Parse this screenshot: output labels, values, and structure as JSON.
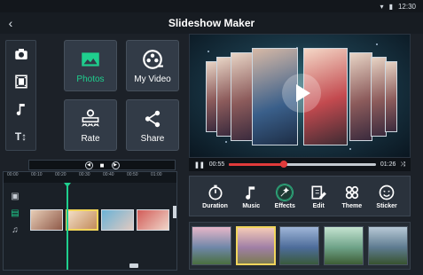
{
  "status": {
    "time": "12:30"
  },
  "app": {
    "title": "Slideshow Maker",
    "back_icon": "back-arrow-icon"
  },
  "tools": [
    {
      "name": "camera-icon"
    },
    {
      "name": "film-icon"
    },
    {
      "name": "music-note-icon"
    },
    {
      "name": "text-icon",
      "glyph": "T↕"
    }
  ],
  "tiles": {
    "photos": "Photos",
    "my_video": "My Video",
    "rate": "Rate",
    "share": "Share"
  },
  "player": {
    "current_time": "00:55",
    "total_time": "01:26",
    "progress": 0.37
  },
  "effects": [
    {
      "label": "Duration",
      "icon": "timer-icon"
    },
    {
      "label": "Music",
      "icon": "music-note-icon"
    },
    {
      "label": "Effects",
      "icon": "magic-icon",
      "active": true
    },
    {
      "label": "Edit",
      "icon": "edit-icon"
    },
    {
      "label": "Theme",
      "icon": "theme-icon"
    },
    {
      "label": "Sticker",
      "icon": "sticker-icon"
    }
  ],
  "filters": [
    {
      "colors": [
        "#e7b6c9",
        "#6f87a8",
        "#4a6f3f"
      ],
      "selected": false
    },
    {
      "colors": [
        "#f3c9b7",
        "#a07fa6",
        "#7c7b52"
      ],
      "selected": true
    },
    {
      "colors": [
        "#9fb6d8",
        "#4d6c9a",
        "#3a5a3c"
      ],
      "selected": false
    },
    {
      "colors": [
        "#c4e3d0",
        "#6ea288",
        "#3d5d35"
      ],
      "selected": false
    },
    {
      "colors": [
        "#b7c9d6",
        "#5e7b90",
        "#38532f"
      ],
      "selected": false
    }
  ],
  "timeline": {
    "ruler": [
      "00:00",
      "00:10",
      "00:20",
      "00:30",
      "00:40",
      "00:50",
      "01:00"
    ],
    "clips": [
      {
        "colors": [
          "#e7cdb6",
          "#8f5a49"
        ],
        "selected": false
      },
      {
        "colors": [
          "#f2dfc8",
          "#c38b5c"
        ],
        "selected": true
      },
      {
        "colors": [
          "#6bb3d6",
          "#e0c9c1"
        ],
        "selected": false
      },
      {
        "colors": [
          "#d25c59",
          "#f0d6c9"
        ],
        "selected": false
      }
    ]
  }
}
